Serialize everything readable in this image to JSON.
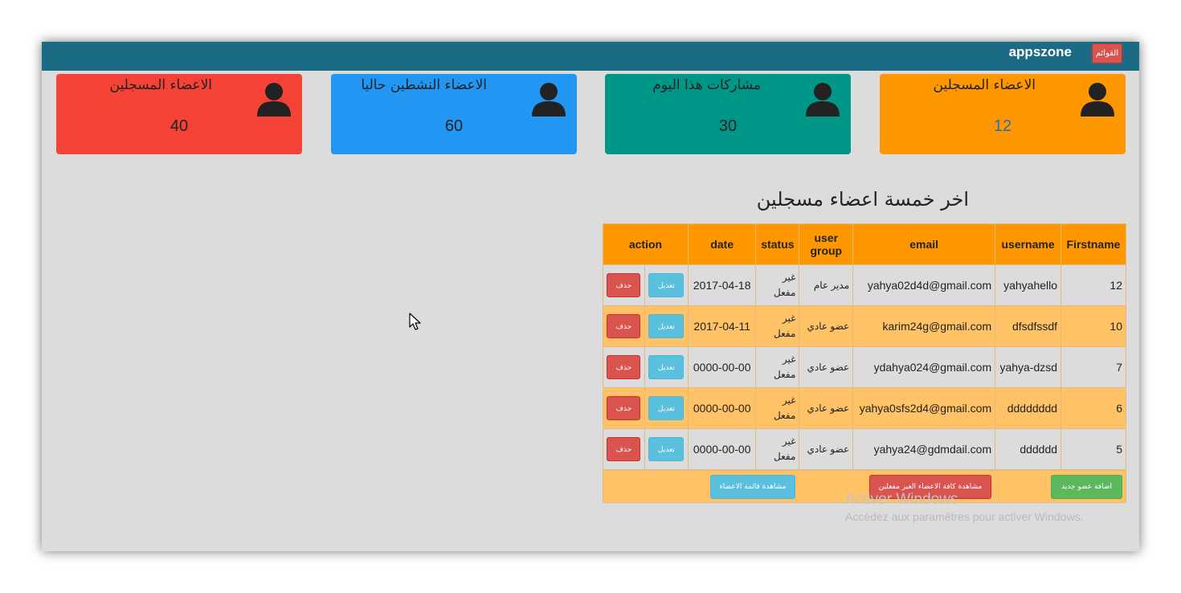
{
  "header": {
    "brand": "appszone",
    "menu_label": "القوائم"
  },
  "stats_cards": [
    {
      "title": "الاعضاء المسجلين",
      "value": "40",
      "color": "#f44336",
      "icon": "user-silhouette-icon"
    },
    {
      "title": "الاعضاء النشطين حاليا",
      "value": "60",
      "color": "#2196f3",
      "icon": "user-silhouette-icon"
    },
    {
      "title": "مشاركات هذا اليوم",
      "value": "30",
      "color": "#009688",
      "icon": "user-silhouette-icon"
    },
    {
      "title": "الاعضاء المسجلين",
      "value": "12",
      "color": "#ff9800",
      "icon": "user-silhouette-icon"
    }
  ],
  "section_title": "اخر خمسة اعضاء مسجلين",
  "table": {
    "columns": [
      "action",
      "date",
      "status",
      "user group",
      "email",
      "username",
      "Firstname"
    ],
    "rows": [
      {
        "firstname": "12",
        "username": "yahyahello",
        "email": "yahya02d4d@gmail.com",
        "group": "مدير عام",
        "status": "غير مفعل",
        "date": "2017-04-18",
        "edit": "تعديل",
        "delete": "حذف"
      },
      {
        "firstname": "10",
        "username": "dfsdfssdf",
        "email": "karim24g@gmail.com",
        "group": "عضو عادي",
        "status": "غير مفعل",
        "date": "2017-04-11",
        "edit": "تعديل",
        "delete": "حذف"
      },
      {
        "firstname": "7",
        "username": "yahya-dzsd",
        "email": "ydahya024@gmail.com",
        "group": "عضو عادي",
        "status": "غير مفعل",
        "date": "0000-00-00",
        "edit": "تعديل",
        "delete": "حذف"
      },
      {
        "firstname": "6",
        "username": "dddddddd",
        "email": "yahya0sfs2d4@gmail.com",
        "group": "عضو عادي",
        "status": "غير مفعل",
        "date": "0000-00-00",
        "edit": "تعديل",
        "delete": "حذف"
      },
      {
        "firstname": "5",
        "username": "dddddd",
        "email": "yahya24@gdmdail.com",
        "group": "عضو عادي",
        "status": "غير مفعل",
        "date": "0000-00-00",
        "edit": "تعديل",
        "delete": "حذف"
      }
    ]
  },
  "footer_buttons": {
    "add_member": "اضافة عضو جديد",
    "view_inactive": "مشاهدة كافة الاعضاء الغير مفعلين",
    "view_list": "مشاهدة قائمة الاعضاء"
  },
  "watermark": {
    "title": "Activer Windows",
    "subtitle": "Accédez aux paramètres pour activer Windows."
  }
}
